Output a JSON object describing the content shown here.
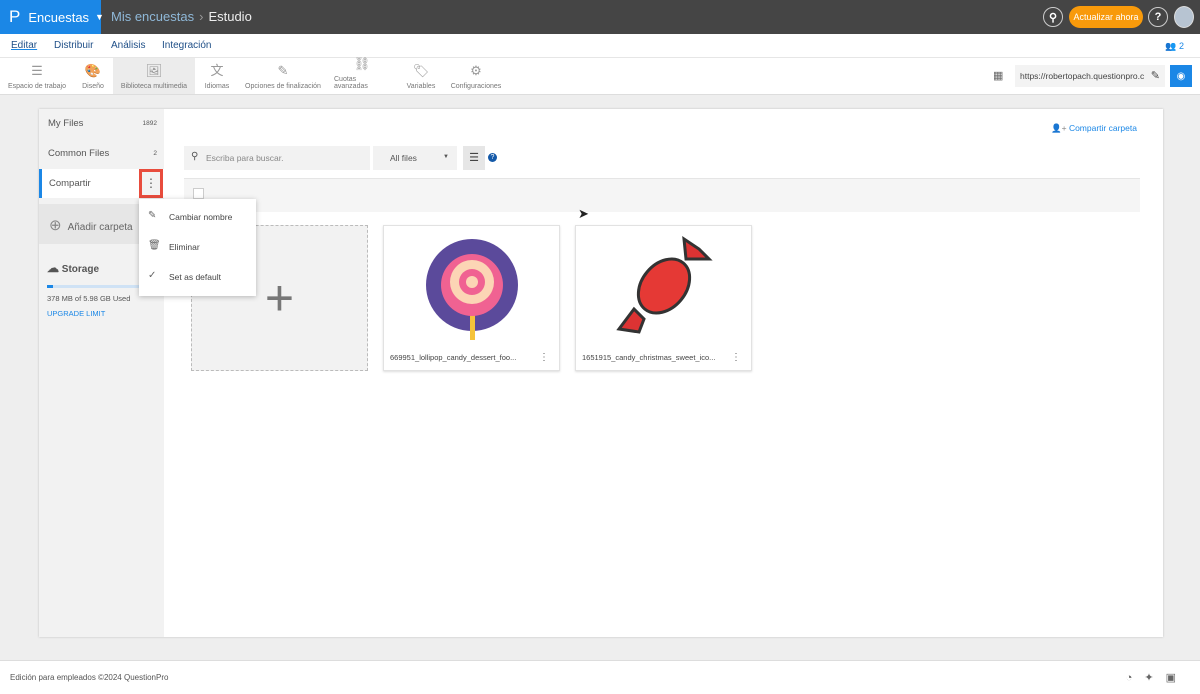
{
  "topbar": {
    "brand": "Encuestas",
    "breadcrumb_parent": "Mis encuestas",
    "breadcrumb_current": "Estudio",
    "upgrade_label": "Actualizar ahora"
  },
  "nav": {
    "tabs": [
      "Editar",
      "Distribuir",
      "Análisis",
      "Integración"
    ],
    "users_count": "2"
  },
  "toolbar": {
    "items": [
      "Espacio de trabajo",
      "Diseño",
      "Biblioteca multimedia",
      "Idiomas",
      "Opciones de finalización",
      "Cuotas avanzadas",
      "Variables",
      "Configuraciones"
    ],
    "url": "https://robertopach.questionpro.com"
  },
  "sidebar": {
    "folders": [
      {
        "label": "My Files",
        "count": "1892"
      },
      {
        "label": "Common Files",
        "count": "2"
      },
      {
        "label": "Compartir"
      }
    ],
    "add_folder": "Añadir carpeta",
    "storage_title": "Storage",
    "storage_used": "378 MB of 5.98 GB Used",
    "storage_fraction": 0.06,
    "upgrade_limit": "UPGRADE LIMIT"
  },
  "context_menu": {
    "items": [
      "Cambiar nombre",
      "Eliminar",
      "Set as default"
    ]
  },
  "main": {
    "share_folder": "Compartir carpeta",
    "search_placeholder": "Escriba para buscar.",
    "filter": "All files",
    "files": [
      {
        "name": "669951_lollipop_candy_dessert_foo..."
      },
      {
        "name": "1651915_candy_christmas_sweet_ico..."
      }
    ]
  },
  "footer": {
    "text": "Edición para empleados ©2024 QuestionPro"
  },
  "colors": {
    "accent": "#1b87e6",
    "upgrade": "#f89a0b",
    "highlight": "#e84c3d"
  }
}
